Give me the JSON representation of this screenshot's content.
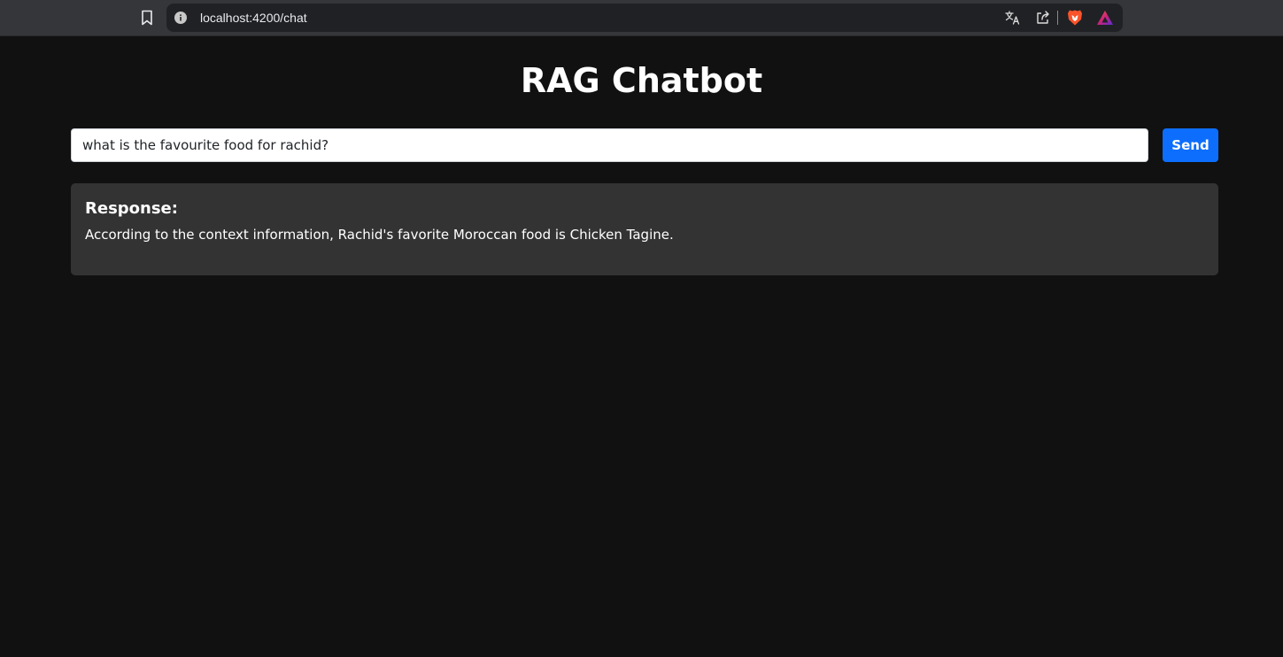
{
  "browser": {
    "url": "localhost:4200/chat",
    "icons": {
      "bookmark": "bookmark-icon",
      "info": "info-icon",
      "translate": "translate-icon",
      "share": "share-icon",
      "brave": "brave-lion-icon",
      "rewards": "brave-rewards-icon"
    }
  },
  "page": {
    "title": "RAG Chatbot"
  },
  "chat": {
    "input_value": "what is the favourite food for rachid?",
    "send_label": "Send",
    "response_heading": "Response:",
    "response_text": "According to the context information, Rachid's favorite Moroccan food is Chicken Tagine."
  },
  "colors": {
    "background": "#111111",
    "card": "#333333",
    "accent": "#0d6efd",
    "browser_bar": "#35363a",
    "omnibox": "#202124"
  }
}
